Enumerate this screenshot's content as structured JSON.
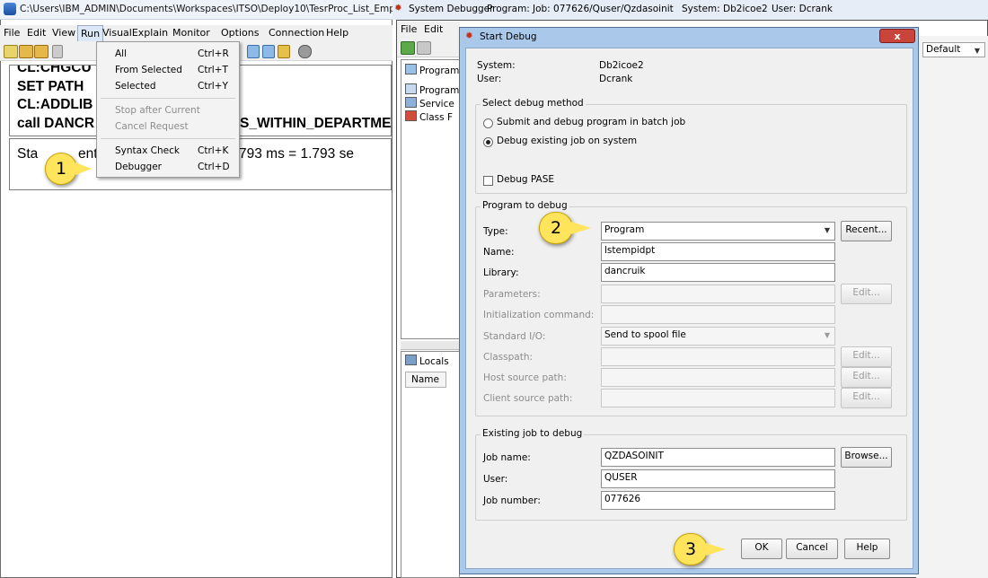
{
  "left_window": {
    "title": "C:\\Users\\IBM_ADMIN\\Documents\\Workspaces\\ITSO\\Deploy10\\TesrProc_List_Emplo",
    "menu": [
      "File",
      "Edit",
      "View",
      "Run",
      "VisualExplain",
      "Monitor",
      "Options",
      "Connection",
      "Help"
    ],
    "code_lines": [
      "CL:CHGCU",
      "SET PATH",
      "CL:ADDLIB",
      "call DANCR"
    ],
    "code_tail": "S_WITHIN_DEPARTME",
    "output_prefix": "Sta",
    "output_mid": "ent",
    "output_tail": "793 ms  =  1.793 se"
  },
  "run_menu": {
    "items": [
      {
        "label": "All",
        "shortcut": "Ctrl+R"
      },
      {
        "label": "From Selected",
        "shortcut": "Ctrl+T"
      },
      {
        "label": "Selected",
        "shortcut": "Ctrl+Y"
      },
      {
        "label": "Stop after Current",
        "shortcut": ""
      },
      {
        "label": "Cancel Request",
        "shortcut": ""
      },
      {
        "label": "Syntax Check",
        "shortcut": "Ctrl+K"
      },
      {
        "label": "Debugger",
        "shortcut": "Ctrl+D"
      }
    ]
  },
  "debugger_window": {
    "title_app": "System Debugger",
    "title_program": "Program:",
    "title_job": "Job: 077626/Quser/Qzdasoinit",
    "title_system": "System: Db2icoe2",
    "title_user": "User: Dcrank",
    "menu": [
      "File",
      "Edit"
    ],
    "tree": [
      "Program",
      "Program",
      "Service",
      "Class F"
    ],
    "locals_tab": "Locals",
    "locals_col": "Name",
    "default_select": "Default"
  },
  "dialog": {
    "title": "Start Debug",
    "close": "x",
    "system_label": "System:",
    "system_value": "Db2icoe2",
    "user_label": "User:",
    "user_value": "Dcrank",
    "method_group": "Select debug method",
    "method_batch": "Submit and debug program in batch job",
    "method_existing": "Debug existing job on system",
    "debug_pase": "Debug PASE",
    "program_group": "Program to debug",
    "type_label": "Type:",
    "type_value": "Program",
    "recent": "Recent...",
    "name_label": "Name:",
    "name_value": "lstempidpt",
    "library_label": "Library:",
    "library_value": "dancruik",
    "parameters_label": "Parameters:",
    "init_label": "Initialization command:",
    "stdio_label": "Standard I/O:",
    "stdio_value": "Send to spool file",
    "classpath_label": "Classpath:",
    "host_label": "Host source path:",
    "client_label": "Client source path:",
    "edit": "Edit...",
    "job_group": "Existing job to debug",
    "job_name_label": "Job name:",
    "job_name_value": "QZDASOINIT",
    "browse": "Browse...",
    "job_user_label": "User:",
    "job_user_value": "QUSER",
    "job_number_label": "Job number:",
    "job_number_value": "077626",
    "ok": "OK",
    "cancel": "Cancel",
    "help": "Help"
  },
  "callouts": [
    "1",
    "2",
    "3"
  ]
}
